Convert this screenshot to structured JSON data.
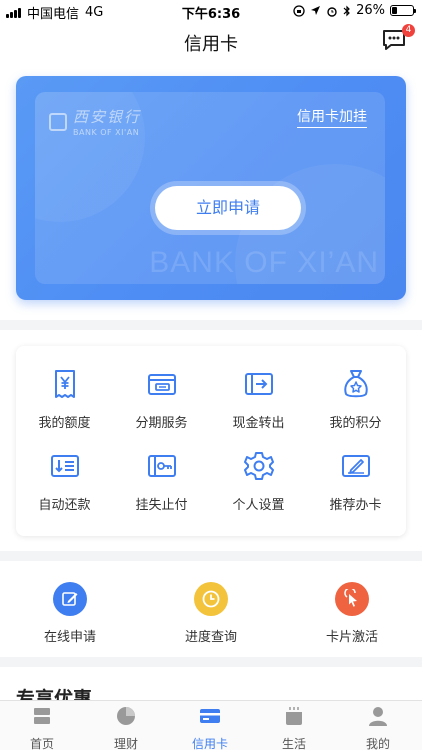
{
  "status_bar": {
    "carrier": "中国电信",
    "network": "4G",
    "time": "下午6:36",
    "battery_percent_text": "26%",
    "battery_level": 0.26
  },
  "nav": {
    "title": "信用卡",
    "message_badge": "4"
  },
  "banner": {
    "bank_name": "西安银行",
    "bank_name_en": "BANK OF XI'AN",
    "add_card_link": "信用卡加挂",
    "apply_button": "立即申请",
    "watermark": "BANK OF XI’AN"
  },
  "services": [
    {
      "label": "我的额度",
      "icon": "receipt-yen-icon"
    },
    {
      "label": "分期服务",
      "icon": "card-installment-icon"
    },
    {
      "label": "现金转出",
      "icon": "cash-transfer-icon"
    },
    {
      "label": "我的积分",
      "icon": "points-bag-icon"
    },
    {
      "label": "自动还款",
      "icon": "auto-repay-icon"
    },
    {
      "label": "挂失止付",
      "icon": "report-loss-icon"
    },
    {
      "label": "个人设置",
      "icon": "gear-icon"
    },
    {
      "label": "推荐办卡",
      "icon": "recommend-card-icon"
    }
  ],
  "quick_actions": [
    {
      "label": "在线申请",
      "icon": "pencil-icon",
      "color": "#3f7ef0"
    },
    {
      "label": "进度查询",
      "icon": "clock-icon",
      "color": "#f3c33b"
    },
    {
      "label": "卡片激活",
      "icon": "cursor-click-icon",
      "color": "#ef6340"
    }
  ],
  "section_title": "专享优惠",
  "tabs": [
    {
      "label": "首页",
      "icon": "home-icon",
      "active": false
    },
    {
      "label": "理财",
      "icon": "pie-chart-icon",
      "active": false
    },
    {
      "label": "信用卡",
      "icon": "credit-card-icon",
      "active": true
    },
    {
      "label": "生活",
      "icon": "cup-icon",
      "active": false
    },
    {
      "label": "我的",
      "icon": "user-icon",
      "active": false
    }
  ],
  "colors": {
    "accent": "#3f7ef0",
    "badge": "#f0423c",
    "card_bg": "#4f8ef4"
  }
}
